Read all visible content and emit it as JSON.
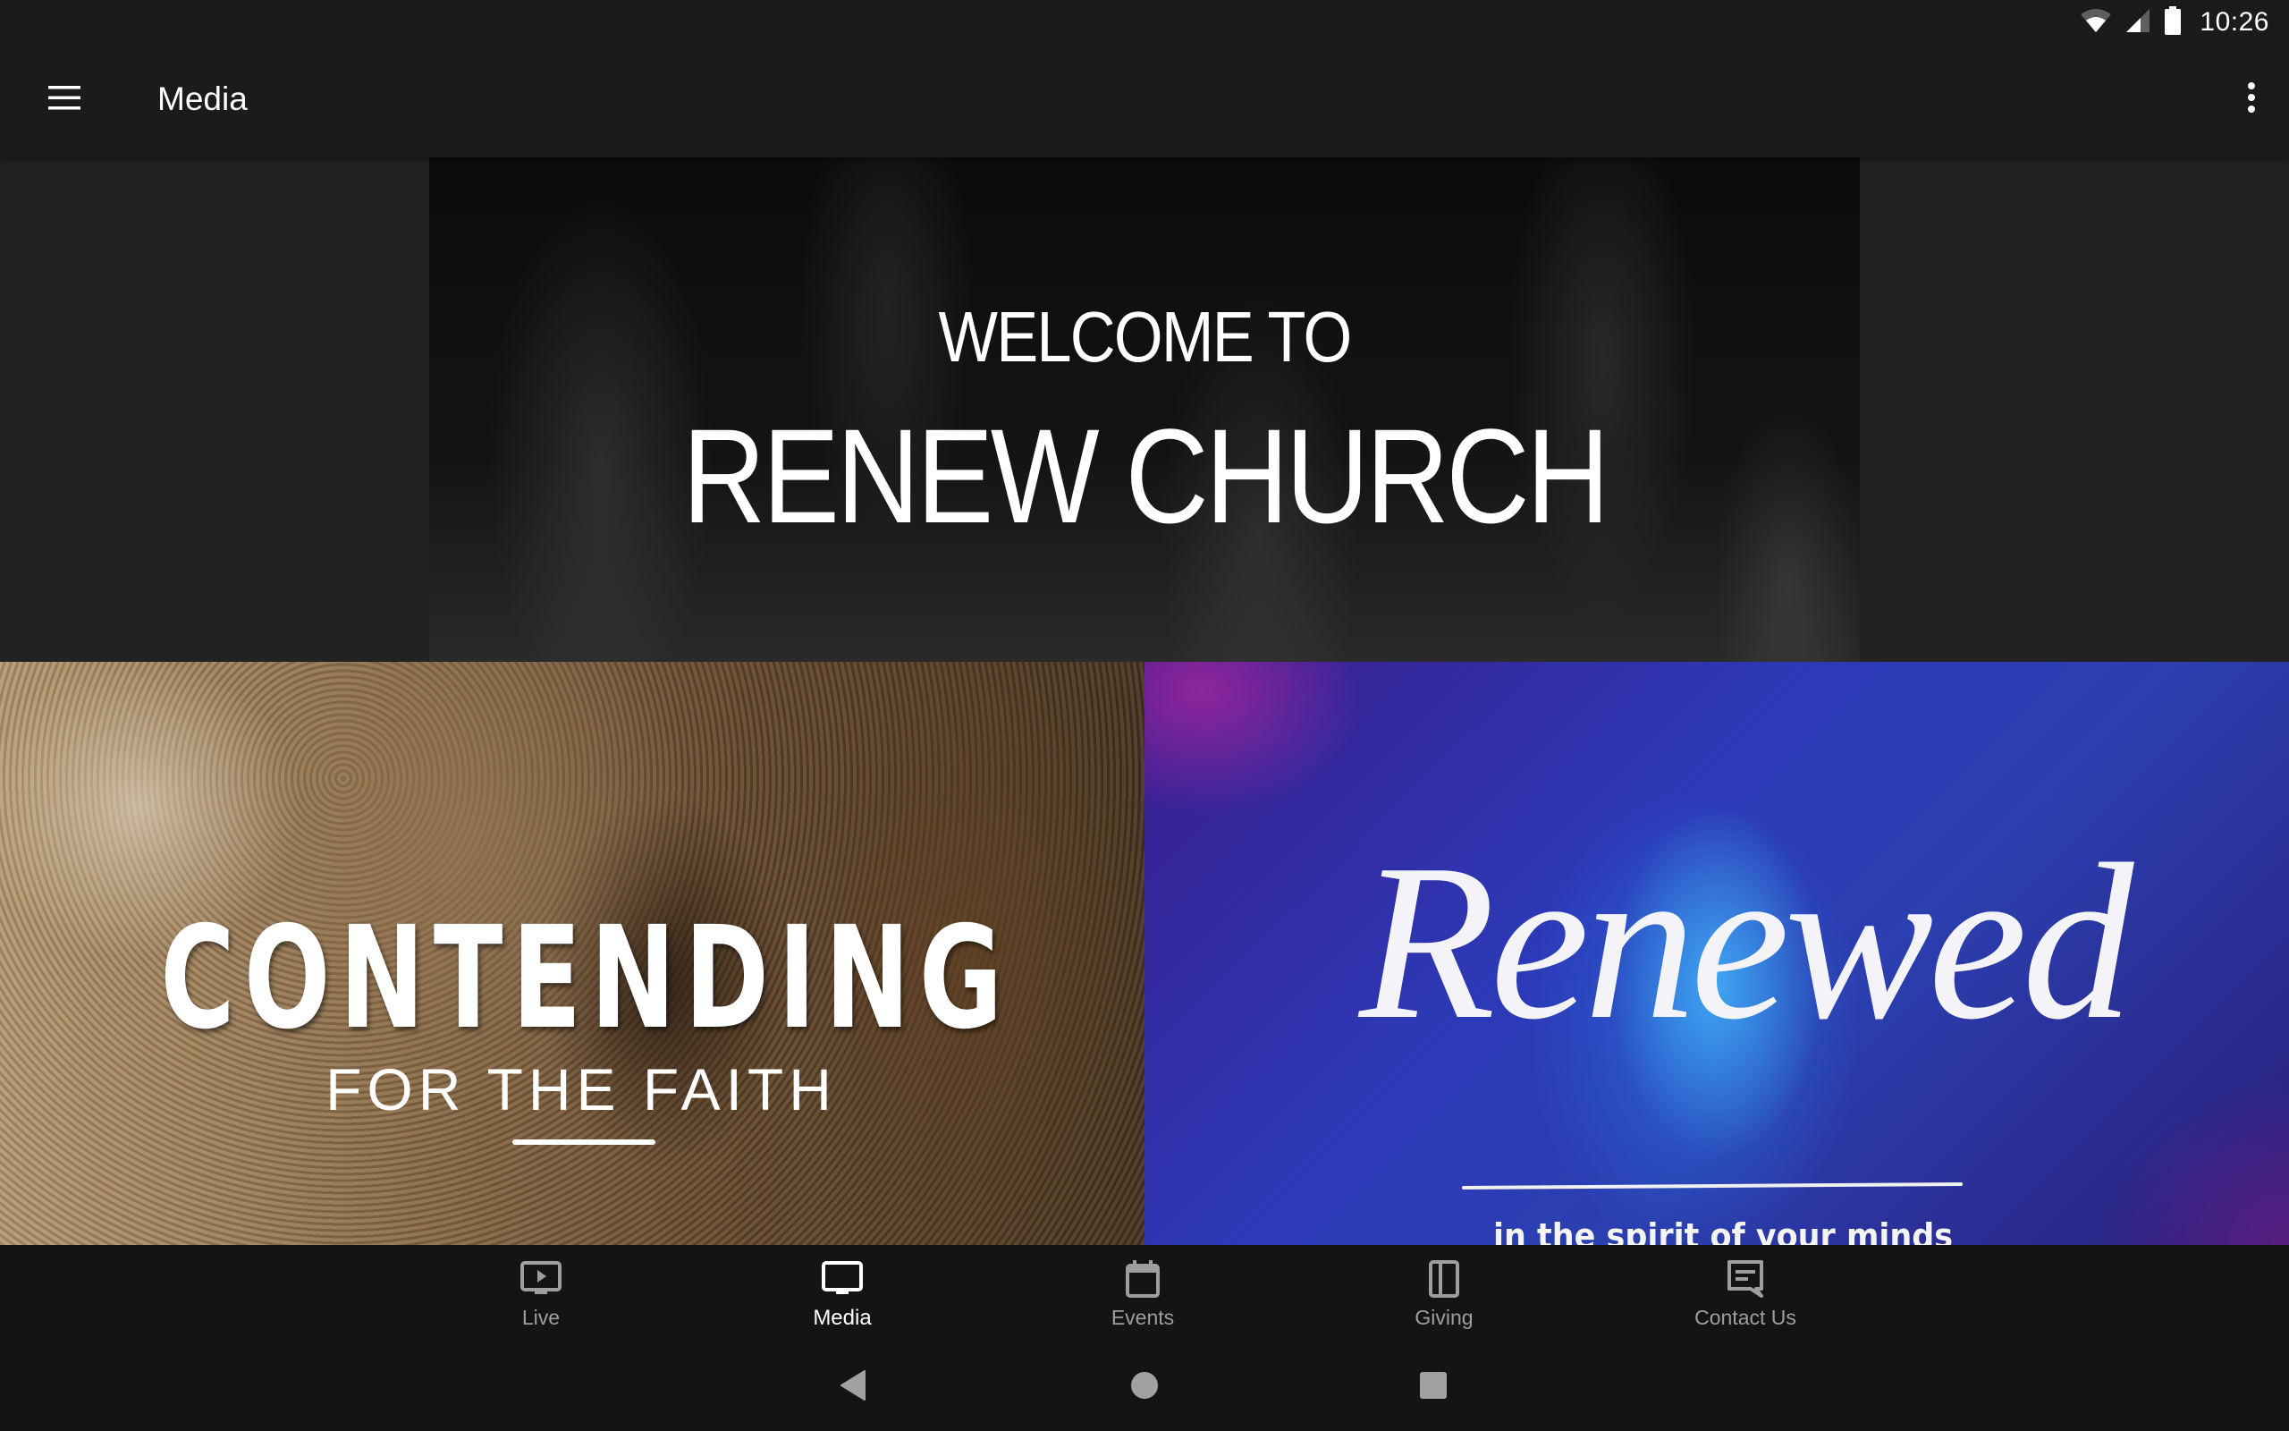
{
  "status_bar": {
    "time": "10:26",
    "icons": [
      "wifi-icon",
      "cellular-signal-icon",
      "battery-icon"
    ]
  },
  "app_bar": {
    "title": "Media",
    "menu_icon": "hamburger-menu-icon",
    "overflow_icon": "more-vert-icon"
  },
  "banner": {
    "line1": "WELCOME TO",
    "line2": "RENEW CHURCH"
  },
  "tiles": [
    {
      "title": "CONTENDING",
      "subtitle": "FOR THE FAITH"
    },
    {
      "title": "Renewed",
      "subtitle": "in the spirit of your minds"
    }
  ],
  "bottom_nav": {
    "items": [
      {
        "label": "Live",
        "icon": "live-tv-icon",
        "active": false
      },
      {
        "label": "Media",
        "icon": "tv-icon",
        "active": true
      },
      {
        "label": "Events",
        "icon": "calendar-icon",
        "active": false
      },
      {
        "label": "Giving",
        "icon": "book-icon",
        "active": false
      },
      {
        "label": "Contact Us",
        "icon": "chat-icon",
        "active": false
      }
    ]
  },
  "system_nav": {
    "buttons": [
      "back",
      "home",
      "recents"
    ]
  },
  "colors": {
    "app_bar": "#1b1b1b",
    "content_bg": "#222222",
    "bottom_nav": "#131416",
    "nav_inactive": "#9e9e9e",
    "nav_active": "#ffffff"
  }
}
